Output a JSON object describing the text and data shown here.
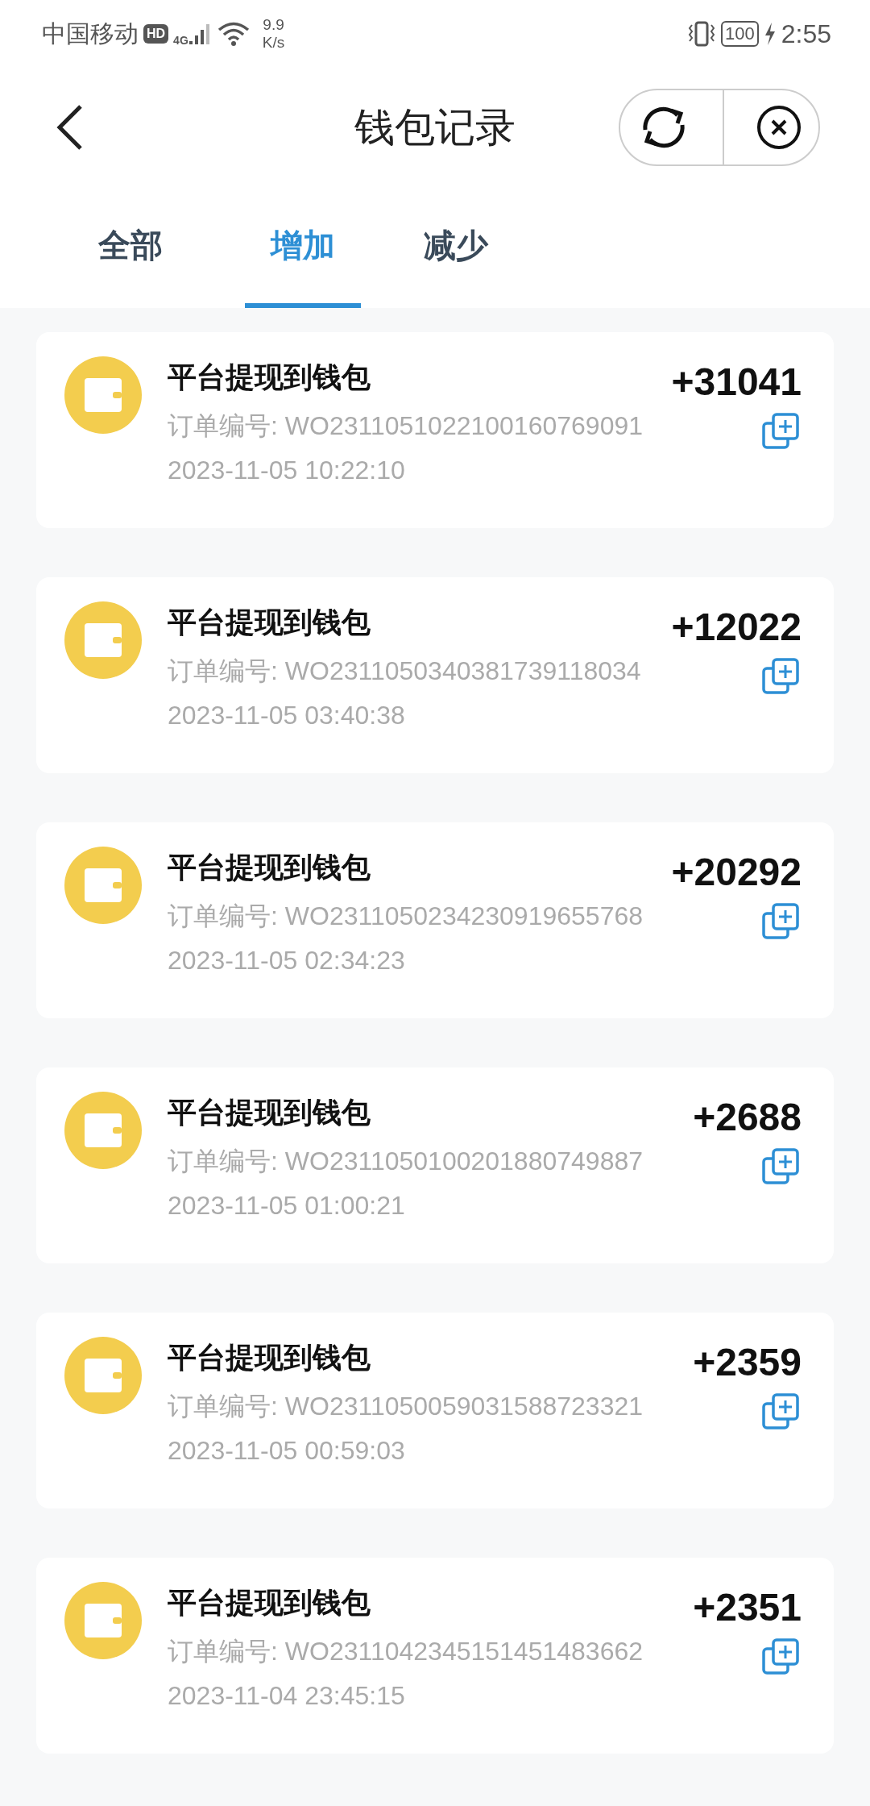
{
  "status_bar": {
    "carrier": "中国移动",
    "hd": "HD",
    "network": "4G",
    "speed_value": "9.9",
    "speed_unit": "K/s",
    "battery": "100",
    "time": "2:55"
  },
  "header": {
    "title": "钱包记录"
  },
  "tabs": [
    {
      "label": "全部",
      "selected": false
    },
    {
      "label": "增加",
      "selected": true
    },
    {
      "label": "减少",
      "selected": false
    }
  ],
  "records": [
    {
      "title": "平台提现到钱包",
      "amount": "+31041",
      "order_label": "订单编号:",
      "order_no": "WO2311051022100160769091",
      "time": "2023-11-05 10:22:10"
    },
    {
      "title": "平台提现到钱包",
      "amount": "+12022",
      "order_label": "订单编号:",
      "order_no": "WO2311050340381739118034",
      "time": "2023-11-05 03:40:38"
    },
    {
      "title": "平台提现到钱包",
      "amount": "+20292",
      "order_label": "订单编号:",
      "order_no": "WO2311050234230919655768",
      "time": "2023-11-05 02:34:23"
    },
    {
      "title": "平台提现到钱包",
      "amount": "+2688",
      "order_label": "订单编号:",
      "order_no": "WO2311050100201880749887",
      "time": "2023-11-05 01:00:21"
    },
    {
      "title": "平台提现到钱包",
      "amount": "+2359",
      "order_label": "订单编号:",
      "order_no": "WO2311050059031588723321",
      "time": "2023-11-05 00:59:03"
    },
    {
      "title": "平台提现到钱包",
      "amount": "+2351",
      "order_label": "订单编号:",
      "order_no": "WO2311042345151451483662",
      "time": "2023-11-04 23:45:15"
    }
  ]
}
